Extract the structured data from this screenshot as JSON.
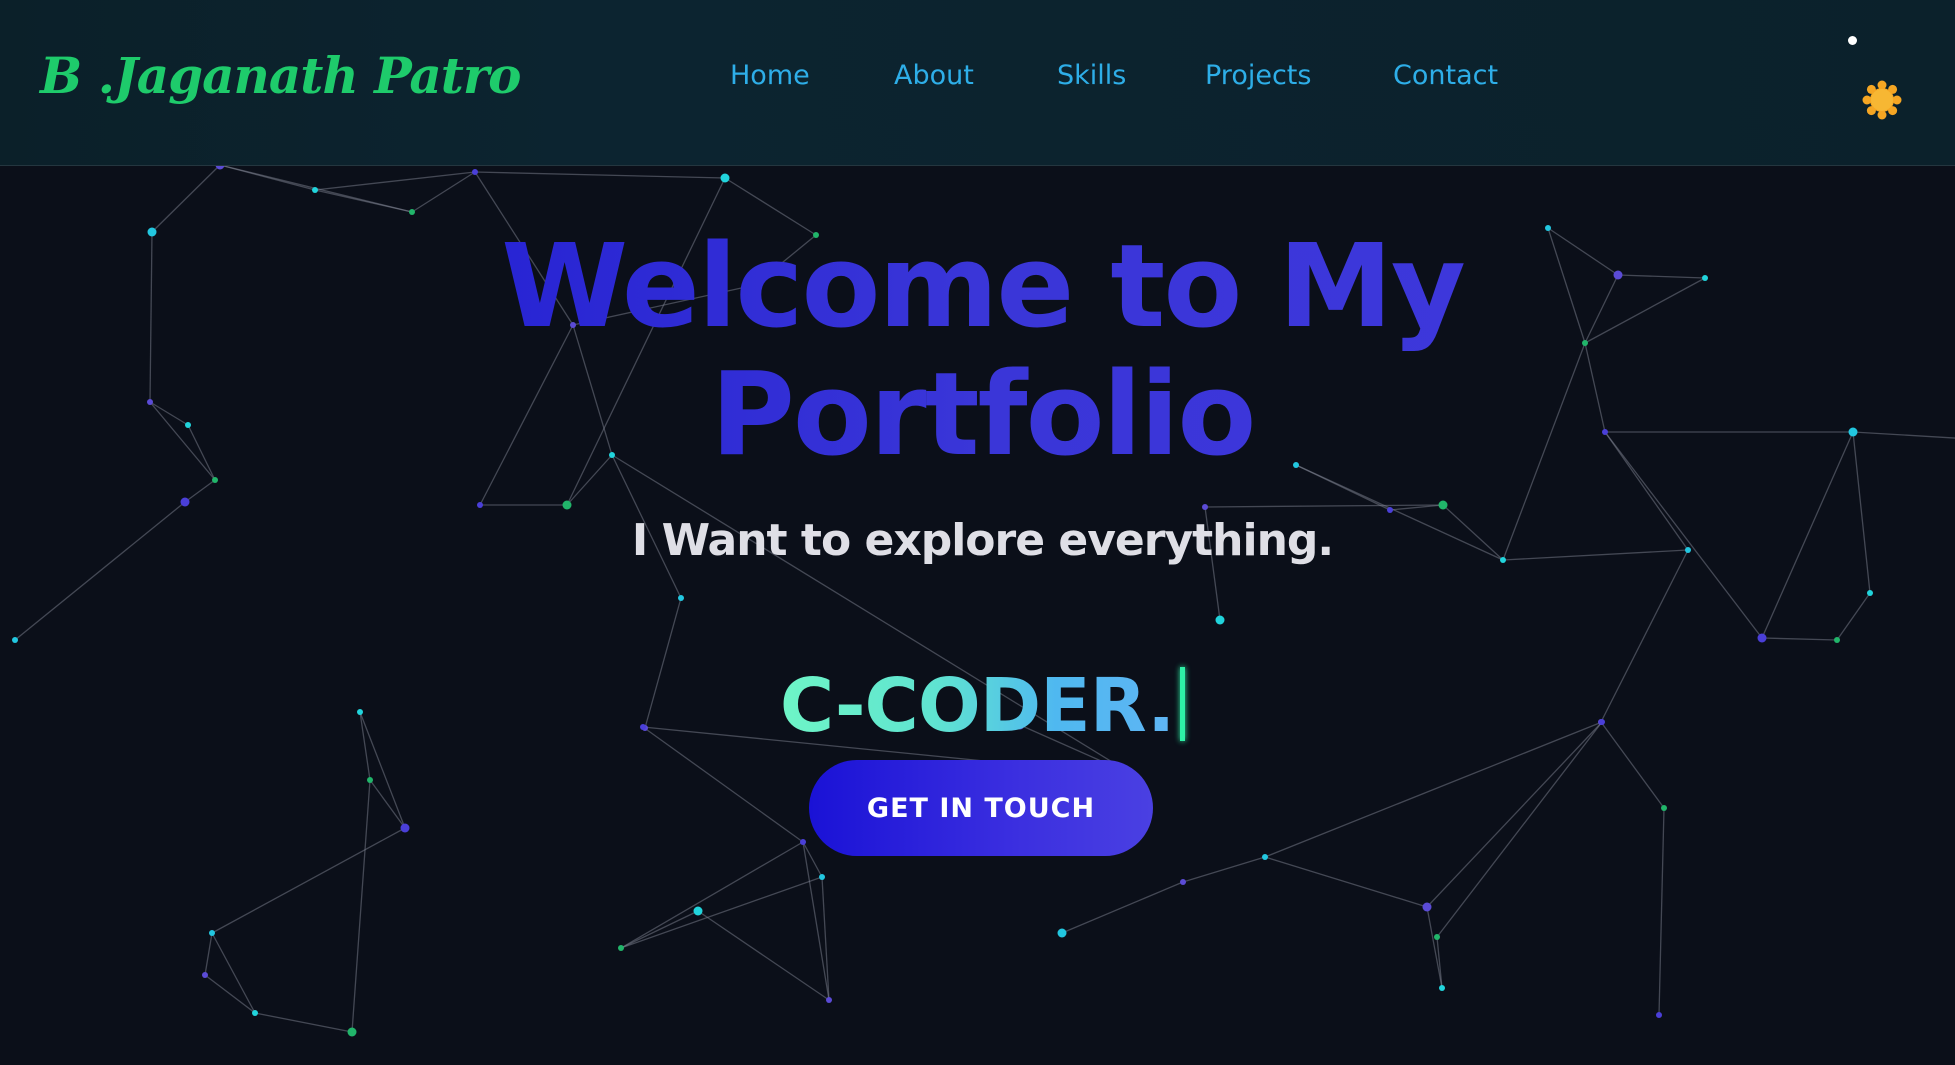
{
  "brand": {
    "logo_text": "B .Jaganath Patro"
  },
  "nav": {
    "items": [
      {
        "label": "Home"
      },
      {
        "label": "About"
      },
      {
        "label": "Skills"
      },
      {
        "label": "Projects"
      },
      {
        "label": "Contact"
      }
    ]
  },
  "theme_toggle": {
    "icon": "sun-icon"
  },
  "hero": {
    "title": "Welcome to My\nPortfolio",
    "subtitle": "I Want to explore everything.",
    "typed_text": "C-CODER.",
    "cta_label": "GET IN TOUCH"
  },
  "colors": {
    "background": "#0b0f19",
    "navbar": "#0c2430",
    "logo": "#1ecb6b",
    "nav_link": "#2eaee8",
    "title": "#2a24d6",
    "subtitle": "#dfdfe6",
    "typed_gradient_start": "#6ef5c6",
    "typed_gradient_end": "#5fb5f4",
    "cta": "#2a20da",
    "sun": "#f5a623"
  }
}
